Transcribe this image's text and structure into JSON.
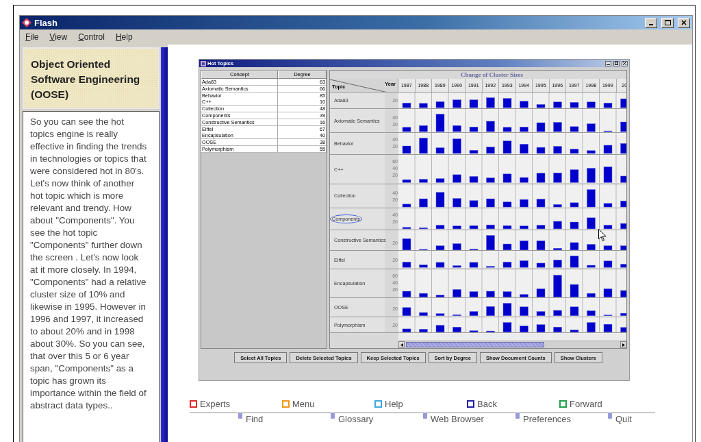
{
  "window": {
    "title": "Flash"
  },
  "menu": [
    "File",
    "View",
    "Control",
    "Help"
  ],
  "sidebar": {
    "heading": "Object Oriented Software Engineering (OOSE)",
    "text": "So you can see the hot topics engine is really effective in finding the trends in technologies or topics that were considered hot in 80's. Let's now think of another hot topic which is more relevant and trendy. How about \"Components\". You see the hot topic \"Components\" further down the screen . Let's now look at it more closely. In 1994, \"Components\" had a relative cluster size of 10% and likewise in 1995. However in 1996 and 1997, it increased to about 20% and in 1998 about 30%. So you can see, that over this 5 or 6 year span, \"Components\" as a topic has grown its importance within the field of abstract data types.."
  },
  "hot_topics": {
    "title": "Hot Topics",
    "table": {
      "columns": [
        "Concept",
        "Degree"
      ],
      "rows": [
        {
          "concept": "Ada83",
          "degree": "63"
        },
        {
          "concept": "Axiomatic Semantics",
          "degree": "66"
        },
        {
          "concept": "Behavior",
          "degree": "85"
        },
        {
          "concept": "C++",
          "degree": "10"
        },
        {
          "concept": "Collection",
          "degree": "48"
        },
        {
          "concept": "Components",
          "degree": "39"
        },
        {
          "concept": "Constructive Semantics",
          "degree": "16"
        },
        {
          "concept": "Eiffel",
          "degree": "67"
        },
        {
          "concept": "Encapsulation",
          "degree": "40"
        },
        {
          "concept": "OOSE",
          "degree": "38"
        },
        {
          "concept": "Polymorphism",
          "degree": "55"
        }
      ]
    },
    "chart": {
      "title": "Change of Cluster Sizes",
      "corner_top": "Year",
      "corner_bottom": "Topic",
      "years": [
        "1987",
        "1988",
        "1989",
        "1990",
        "1991",
        "1992",
        "1993",
        "1994",
        "1995",
        "1996",
        "1997",
        "1998",
        "1999",
        "20"
      ],
      "rows": [
        {
          "topic": "Ada83",
          "circled": false,
          "ticks": [
            "20"
          ]
        },
        {
          "topic": "Axiomatic Semantics",
          "circled": false,
          "ticks": [
            "40",
            "20"
          ]
        },
        {
          "topic": "Behavior",
          "circled": false,
          "ticks": [
            "40",
            "20"
          ]
        },
        {
          "topic": "C++",
          "circled": false,
          "ticks": [
            "60",
            "40",
            "20"
          ]
        },
        {
          "topic": "Collection",
          "circled": false,
          "ticks": [
            "40",
            "20"
          ]
        },
        {
          "topic": "Components",
          "circled": true,
          "ticks": [
            "40",
            "20"
          ]
        },
        {
          "topic": "Constructive Semantics",
          "circled": false,
          "ticks": [
            "20"
          ]
        },
        {
          "topic": "Eiffel",
          "circled": false,
          "ticks": [
            "20"
          ]
        },
        {
          "topic": "Encapsulation",
          "circled": false,
          "ticks": [
            "60",
            "40",
            "20"
          ]
        },
        {
          "topic": "OOSE",
          "circled": false,
          "ticks": [
            "20"
          ]
        },
        {
          "topic": "Polymorphism",
          "circled": false,
          "ticks": [
            "20"
          ]
        }
      ]
    },
    "buttons": [
      "Select All Topics",
      "Delete Selected Topics",
      "Keep Selected Topics",
      "Sort by Degree",
      "Show Document Counts",
      "Show Clusters"
    ]
  },
  "nav": {
    "upper": [
      {
        "label": "Experts",
        "color": "#e02828"
      },
      {
        "label": "Menu",
        "color": "#f09818"
      },
      {
        "label": "Help",
        "color": "#40a8e0"
      },
      {
        "label": "Back",
        "color": "#2020a8"
      },
      {
        "label": "Forward",
        "color": "#20a048"
      }
    ],
    "lower": [
      {
        "label": "Find"
      },
      {
        "label": "Glossary"
      },
      {
        "label": "Web Browser"
      },
      {
        "label": "Preferences"
      },
      {
        "label": "Quit"
      }
    ]
  }
}
